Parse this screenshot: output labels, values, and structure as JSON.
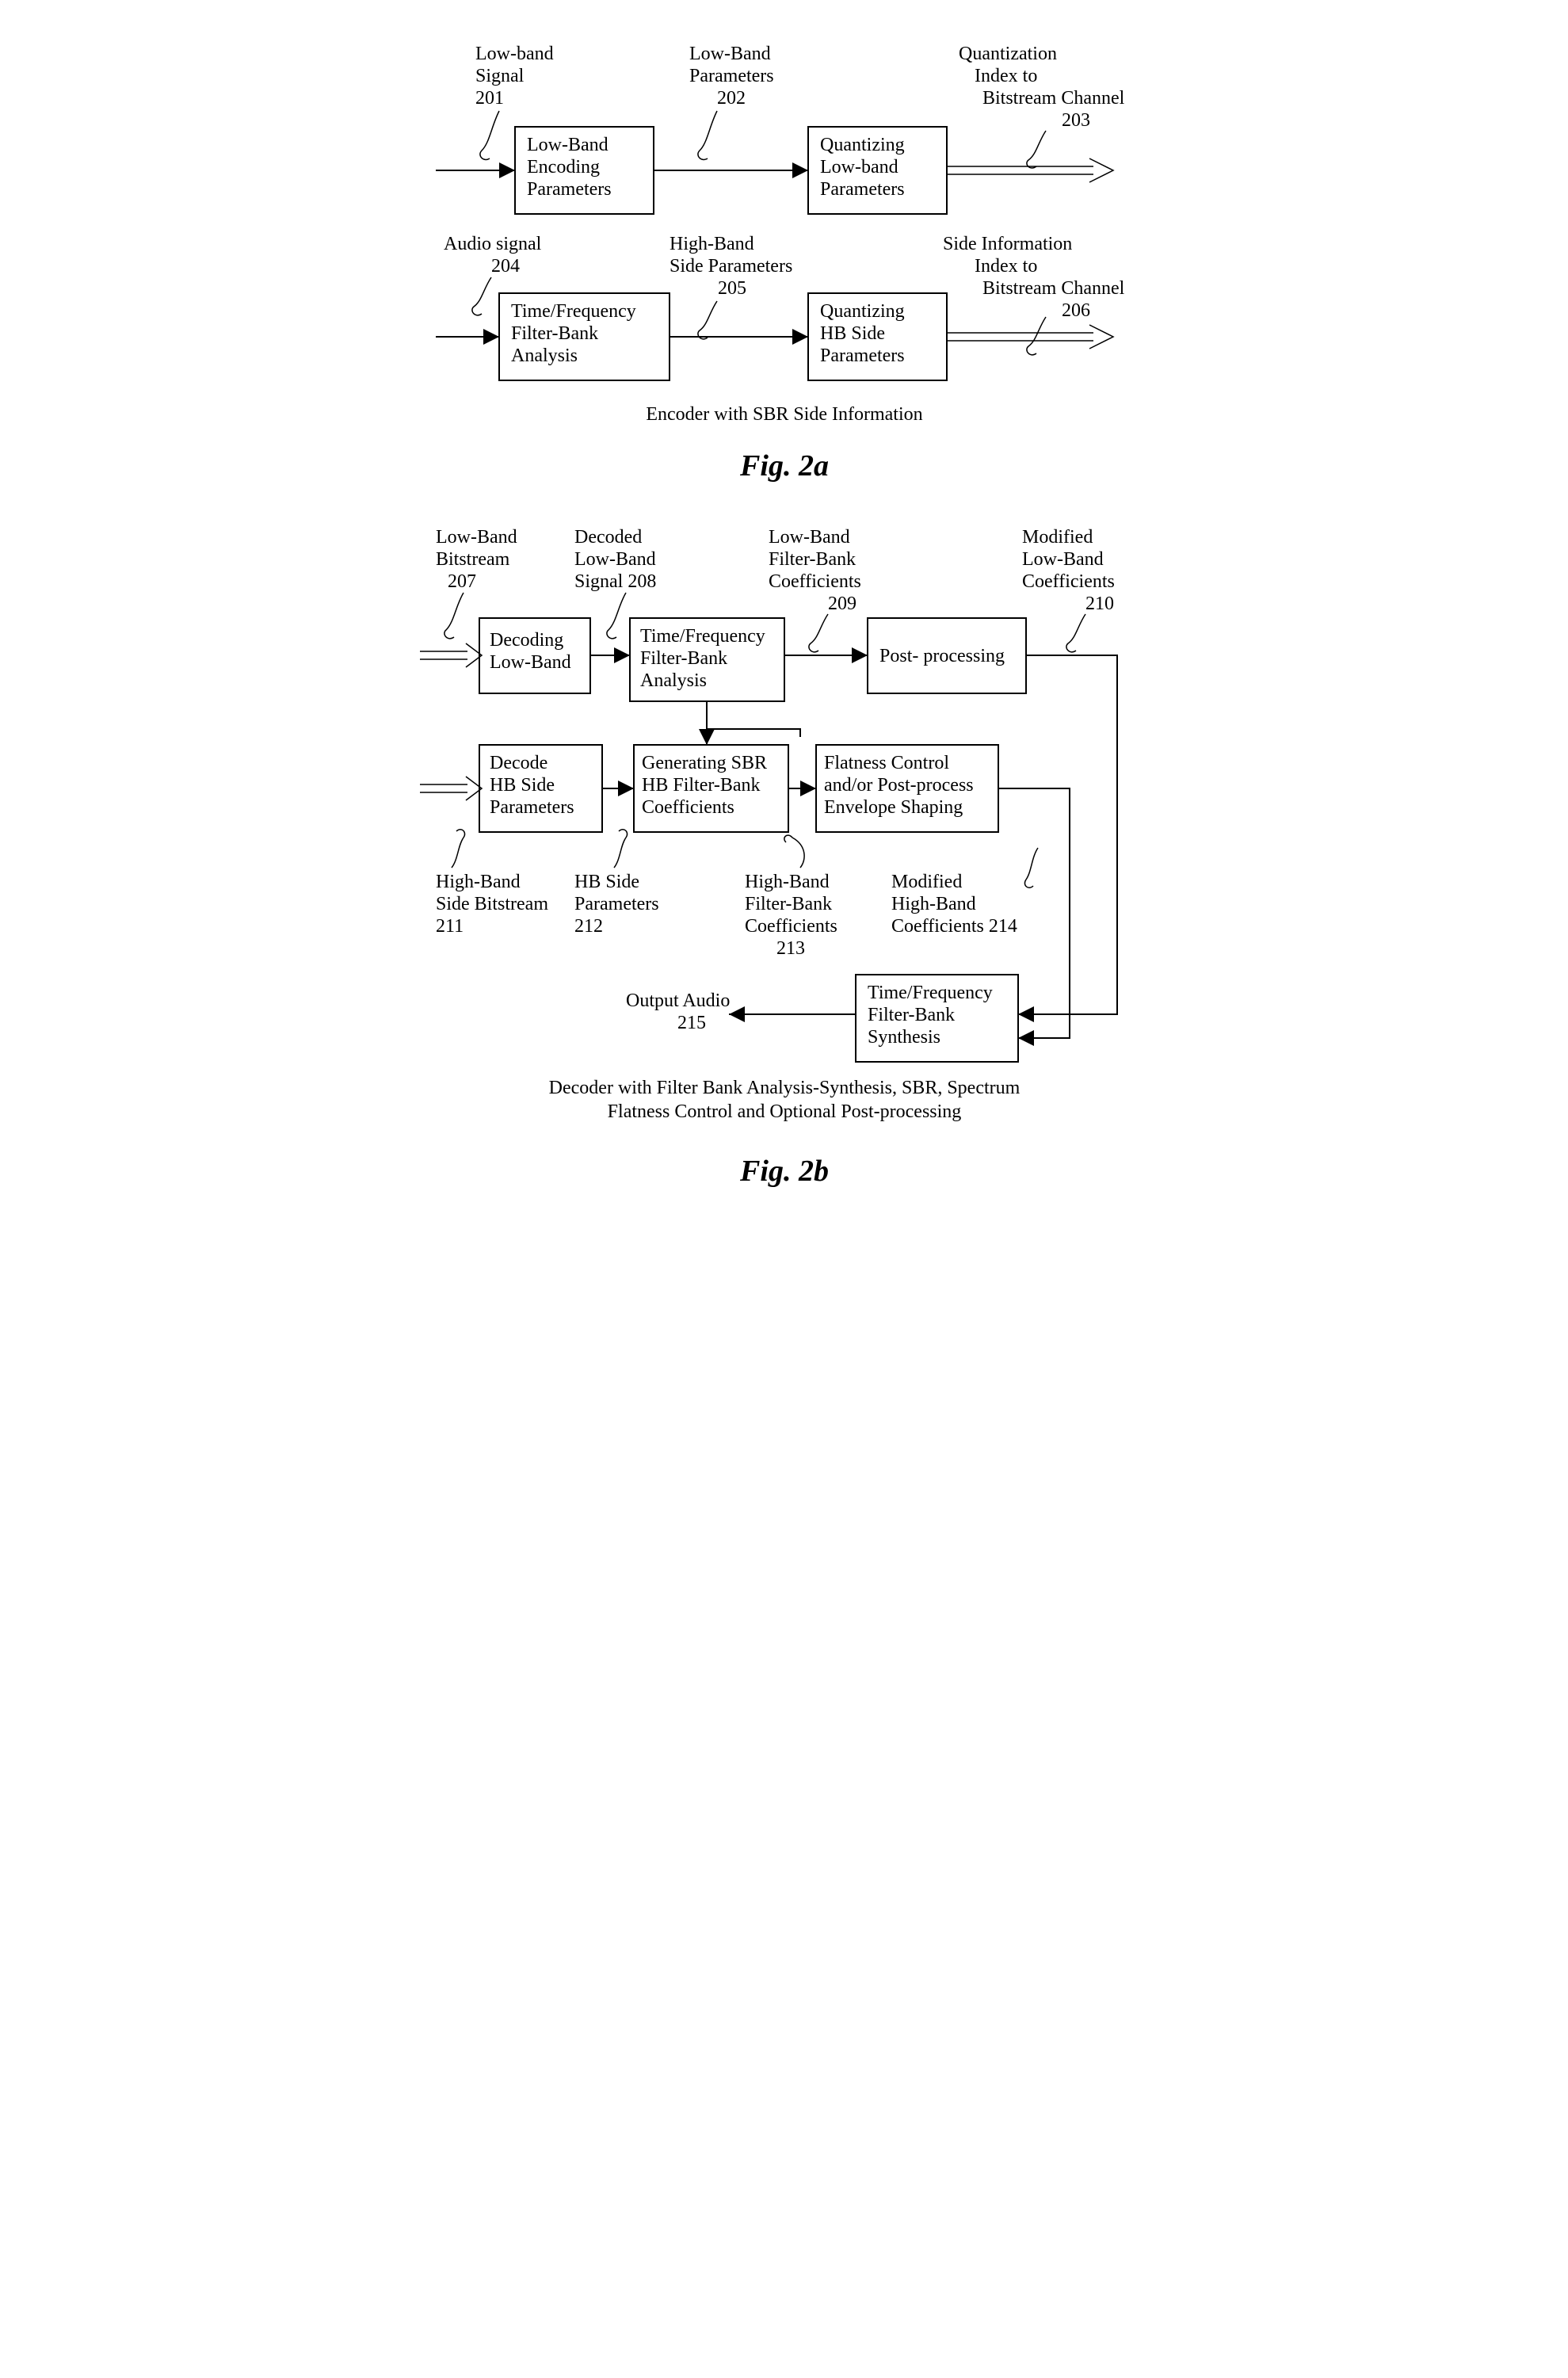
{
  "fig2a": {
    "labels": {
      "low_band_signal": {
        "l1": "Low-band",
        "l2": "Signal",
        "num": "201"
      },
      "low_band_params": {
        "l1": "Low-Band",
        "l2": "Parameters",
        "num": "202"
      },
      "quant_idx": {
        "l1": "Quantization",
        "l2": "Index to",
        "l3": "Bitstream Channel",
        "num": "203"
      },
      "audio_signal": {
        "l1": "Audio signal",
        "num": "204"
      },
      "high_band_side": {
        "l1": "High-Band",
        "l2": "Side Parameters",
        "num": "205"
      },
      "side_info": {
        "l1": "Side Information",
        "l2": "Index to",
        "l3": "Bitstream Channel",
        "num": "206"
      }
    },
    "boxes": {
      "lb_enc": {
        "l1": "Low-Band",
        "l2": "Encoding",
        "l3": "Parameters"
      },
      "quant_lb": {
        "l1": "Quantizing",
        "l2": "Low-band",
        "l3": "Parameters"
      },
      "tf_analysis": {
        "l1": "Time/Frequency",
        "l2": "Filter-Bank",
        "l3": "Analysis"
      },
      "quant_hb": {
        "l1": "Quantizing",
        "l2": "HB Side",
        "l3": "Parameters"
      }
    },
    "caption": "Encoder with SBR Side Information",
    "title": "Fig. 2a"
  },
  "fig2b": {
    "labels": {
      "lb_bitstream": {
        "l1": "Low-Band",
        "l2": "Bitstream",
        "num": "207"
      },
      "decoded_lb": {
        "l1": "Decoded",
        "l2": "Low-Band",
        "l3": "Signal",
        "num": "208"
      },
      "lb_fb_coef": {
        "l1": "Low-Band",
        "l2": "Filter-Bank",
        "l3": "Coefficients",
        "num": "209"
      },
      "mod_lb_coef": {
        "l1": "Modified",
        "l2": "Low-Band",
        "l3": "Coefficients",
        "num": "210"
      },
      "hb_side_bitstream": {
        "l1": "High-Band",
        "l2": "Side Bitstream",
        "num": "211"
      },
      "hb_side_params": {
        "l1": "HB Side",
        "l2": "Parameters",
        "num": "212"
      },
      "hb_fb_coef": {
        "l1": "High-Band",
        "l2": "Filter-Bank",
        "l3": "Coefficients",
        "num": "213"
      },
      "mod_hb_coef": {
        "l1": "Modified",
        "l2": "High-Band",
        "l3": "Coefficients",
        "num": "214"
      },
      "output": {
        "l1": "Output Audio",
        "num": "215"
      }
    },
    "boxes": {
      "dec_lb": {
        "l1": "Decoding",
        "l2": "Low-Band"
      },
      "tf_analysis": {
        "l1": "Time/Frequency",
        "l2": "Filter-Bank",
        "l3": "Analysis"
      },
      "post_proc": {
        "l1": "Post- processing"
      },
      "dec_hb": {
        "l1": "Decode",
        "l2": "HB Side",
        "l3": "Parameters"
      },
      "gen_sbr": {
        "l1": "Generating SBR",
        "l2": "HB Filter-Bank",
        "l3": "Coefficients"
      },
      "flatness": {
        "l1": "Flatness Control",
        "l2": "and/or Post-process",
        "l3": "Envelope Shaping"
      },
      "tf_synth": {
        "l1": "Time/Frequency",
        "l2": "Filter-Bank",
        "l3": "Synthesis"
      }
    },
    "caption1": "Decoder with Filter Bank Analysis-Synthesis, SBR, Spectrum",
    "caption2": "Flatness Control and Optional Post-processing",
    "title": "Fig. 2b"
  }
}
